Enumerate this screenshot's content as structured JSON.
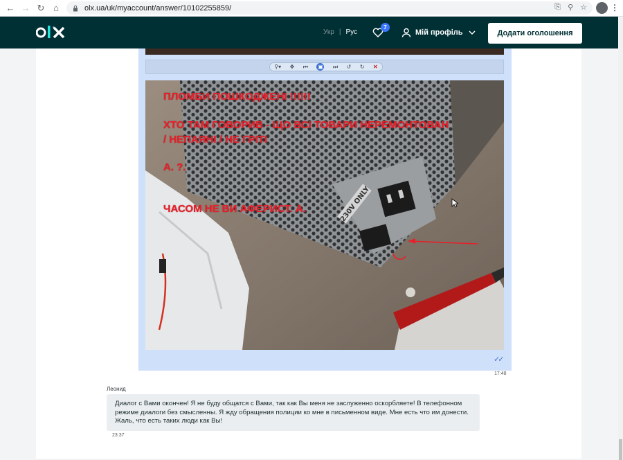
{
  "browser": {
    "url": "olx.ua/uk/myaccount/answer/10102255859/"
  },
  "header": {
    "lang_uk": "Укр",
    "lang_sep": "|",
    "lang_ru": "Рус",
    "favorites_count": "7",
    "profile_label": "Мій профіль",
    "post_ad_label": "Додати оголошення",
    "colors": {
      "header_bg": "#002f34",
      "logo_teal": "#23e5db",
      "badge": "#3a77ff"
    }
  },
  "image_viewer": {
    "toolbar_icons": [
      "zoom-icon",
      "move-icon",
      "prev-icon",
      "fit-icon",
      "next-icon",
      "rotate-left-icon",
      "rotate-right-icon",
      "close-icon"
    ]
  },
  "photo": {
    "lines": [
      "ПЛОМБИ ПОШКОДЖЕНІ !!!!!!",
      "ХТО ТАМ ГОВОРИВ - ЩО ВСІ ТОВАРИ НЕРЕМОНТОВАН",
      "/ НЕПАЯНІ / НЕ ГРІТІ",
      "А. ?.",
      "ЧАСОМ НЕ ВИ АФЕРИСТ. А."
    ],
    "label_on_psu": "230V ONLY"
  },
  "my_message": {
    "time": "17:48",
    "status": "read"
  },
  "their_message": {
    "sender": "Леонид",
    "text": "Диалог с Вами окончен! Я не буду общатся с Вами, так как Вы меня не заслуженно оскорбляете! В телефонном режиме диалоги без смысленны. Я жду обращения полиции ко мне в письменном виде. Мне есть что им донести. Жаль, что есть таких люди как Вы!",
    "time": "23:37"
  }
}
